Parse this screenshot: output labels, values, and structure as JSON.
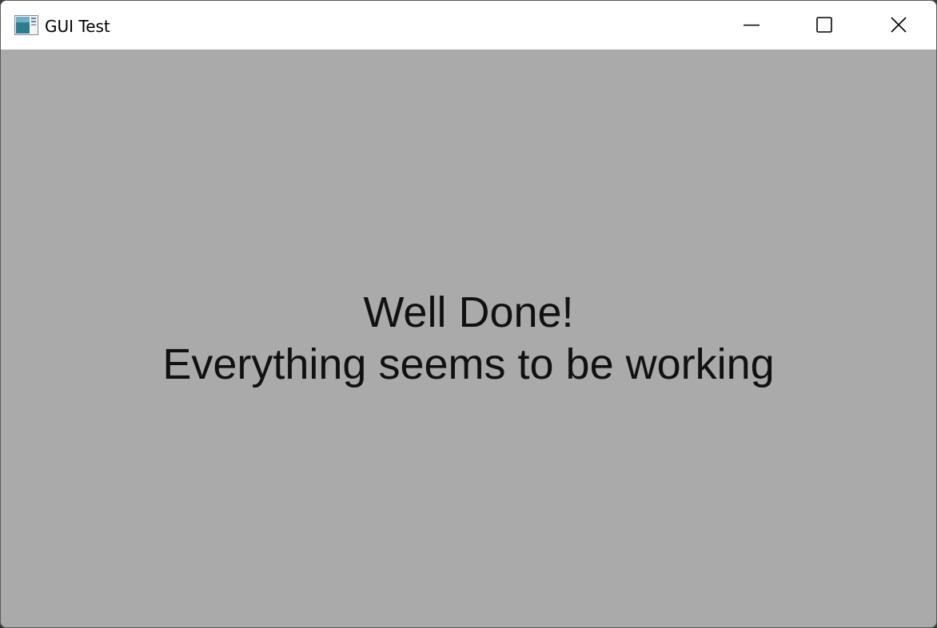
{
  "window": {
    "title": "GUI Test",
    "icon": "app-window-icon"
  },
  "titlebar_buttons": {
    "minimize": "minimize-icon",
    "maximize": "maximize-icon",
    "close": "close-icon"
  },
  "content": {
    "line1": "Well Done!",
    "line2": "Everything seems to be working"
  },
  "colors": {
    "client_background": "#aaaaaa",
    "titlebar_background": "#ffffff",
    "text": "#111111"
  }
}
